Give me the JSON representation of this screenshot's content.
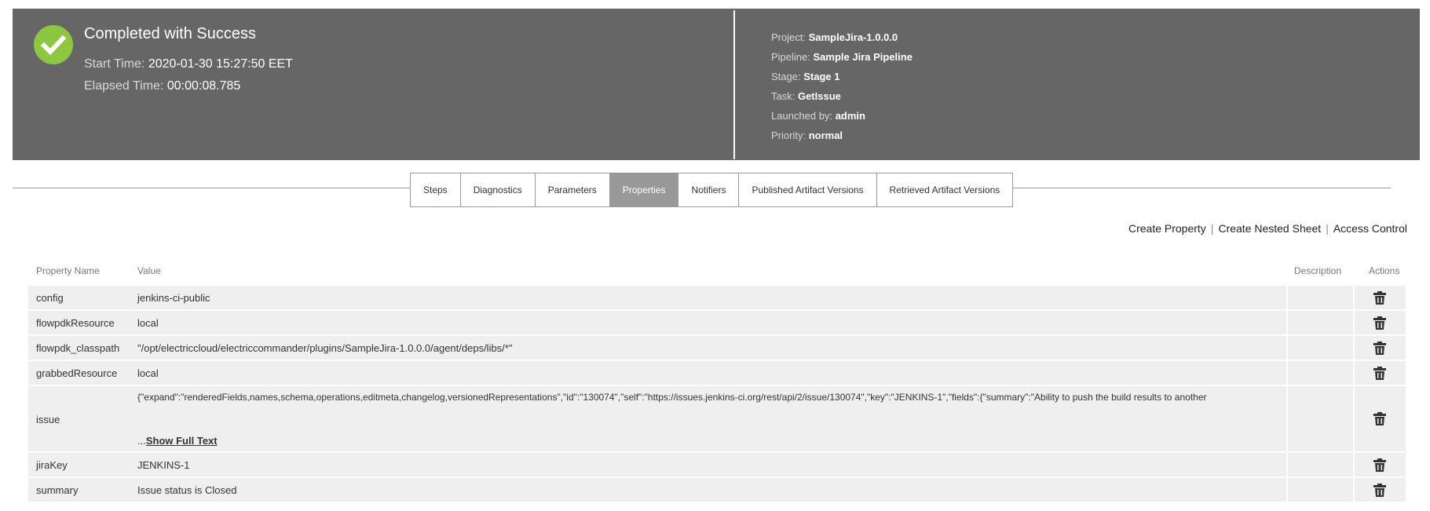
{
  "header": {
    "status": "Completed with Success",
    "start_time_label": "Start Time:",
    "start_time": "2020-01-30 15:27:50 EET",
    "elapsed_label": "Elapsed Time:",
    "elapsed": "00:00:08.785",
    "info": [
      {
        "label": "Project:",
        "value": "SampleJira-1.0.0.0"
      },
      {
        "label": "Pipeline:",
        "value": "Sample Jira Pipeline"
      },
      {
        "label": "Stage:",
        "value": "Stage 1"
      },
      {
        "label": "Task:",
        "value": "GetIssue"
      },
      {
        "label": "Launched by:",
        "value": "admin"
      },
      {
        "label": "Priority:",
        "value": "normal"
      }
    ]
  },
  "tabs": [
    "Steps",
    "Diagnostics",
    "Parameters",
    "Properties",
    "Notifiers",
    "Published Artifact Versions",
    "Retrieved Artifact Versions"
  ],
  "active_tab": "Properties",
  "links": {
    "create_property": "Create Property",
    "create_nested": "Create Nested Sheet",
    "access_control": "Access Control",
    "separator": "|"
  },
  "table": {
    "columns": {
      "name": "Property Name",
      "value": "Value",
      "description": "Description",
      "actions": "Actions"
    },
    "rows": [
      {
        "name": "config",
        "value": "jenkins-ci-public"
      },
      {
        "name": "flowpdkResource",
        "value": "local"
      },
      {
        "name": "flowpdk_classpath",
        "value": "\"/opt/electriccloud/electriccommander/plugins/SampleJira-1.0.0.0/agent/deps/libs/*\""
      },
      {
        "name": "grabbedResource",
        "value": "local"
      },
      {
        "name": "issue",
        "value": "{\"expand\":\"renderedFields,names,schema,operations,editmeta,changelog,versionedRepresentations\",\"id\":\"130074\",\"self\":\"https://issues.jenkins-ci.org/rest/api/2/issue/130074\",\"key\":\"JENKINS-1\",\"fields\":{\"summary\":\"Ability to push the build results to another",
        "ellipsis": "...",
        "show_full": "Show Full Text"
      },
      {
        "name": "jiraKey",
        "value": "JENKINS-1"
      },
      {
        "name": "summary",
        "value": "Issue status is Closed"
      }
    ]
  },
  "colors": {
    "header_bg": "#666667",
    "success": "#8dc63f",
    "active_tab": "#999999",
    "row_bg": "#efefef"
  },
  "icons": {
    "status": "check-circle-icon",
    "row_action": "trash-icon"
  }
}
